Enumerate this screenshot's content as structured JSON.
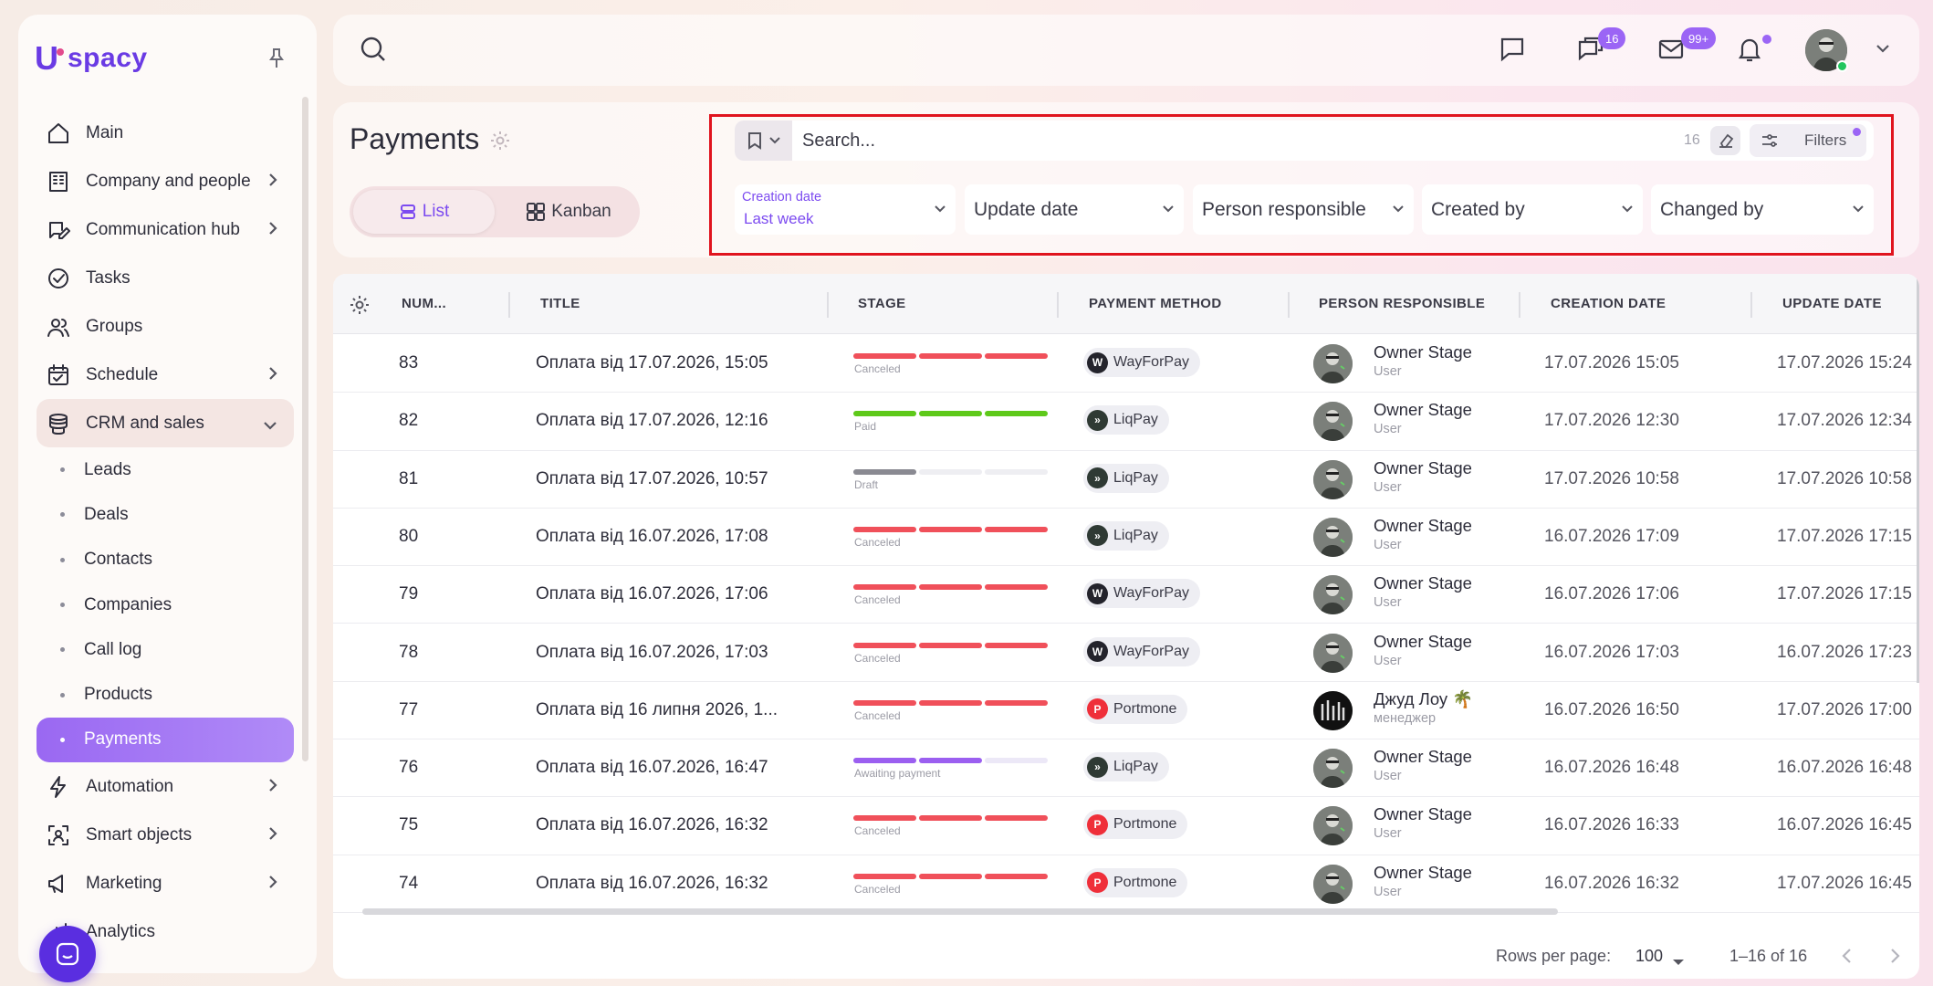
{
  "app": {
    "logo_text": "spacy",
    "logo_u": "U"
  },
  "sidebar": {
    "items": [
      {
        "label": "Main",
        "icon": "home-icon",
        "chevron": false
      },
      {
        "label": "Company and people",
        "icon": "building-icon",
        "chevron": true
      },
      {
        "label": "Communication hub",
        "icon": "edit-chat-icon",
        "chevron": true
      },
      {
        "label": "Tasks",
        "icon": "check-circle-icon",
        "chevron": false
      },
      {
        "label": "Groups",
        "icon": "users-icon",
        "chevron": false
      },
      {
        "label": "Schedule",
        "icon": "calendar-icon",
        "chevron": true
      },
      {
        "label": "CRM and sales",
        "icon": "coins-icon",
        "chevron": "down"
      }
    ],
    "crm_subitems": [
      "Leads",
      "Deals",
      "Contacts",
      "Companies",
      "Call log",
      "Products",
      "Payments"
    ],
    "active_subitem": "Payments",
    "bottom_items": [
      {
        "label": "Automation",
        "icon": "lightning-icon",
        "chevron": true
      },
      {
        "label": "Smart objects",
        "icon": "scan-face-icon",
        "chevron": true
      },
      {
        "label": "Marketing",
        "icon": "megaphone-icon",
        "chevron": true
      },
      {
        "label": "Analytics",
        "icon": "analytics-icon",
        "chevron": false
      }
    ]
  },
  "topbar": {
    "chat_badge": "16",
    "mail_badge": "99+"
  },
  "header": {
    "title": "Payments",
    "views": {
      "list": "List",
      "kanban": "Kanban"
    },
    "search_placeholder": "Search...",
    "search_count": "16",
    "filters_label": "Filters",
    "filters": {
      "creation_date_label": "Creation date",
      "creation_date_value": "Last week",
      "update_date": "Update date",
      "person_responsible": "Person responsible",
      "created_by": "Created by",
      "changed_by": "Changed by"
    }
  },
  "table": {
    "columns": [
      "NUM...",
      "TITLE",
      "STAGE",
      "PAYMENT METHOD",
      "PERSON RESPONSIBLE",
      "CREATION DATE",
      "UPDATE DATE"
    ],
    "rows": [
      {
        "num": "83",
        "title": "Оплата від 17.07.2026, 15:05",
        "stage": "Canceled",
        "method": "WayForPay",
        "person": "Owner Stage",
        "role": "User",
        "created": "17.07.2026 15:05",
        "updated": "17.07.2026 15:24"
      },
      {
        "num": "82",
        "title": "Оплата від 17.07.2026, 12:16",
        "stage": "Paid",
        "method": "LiqPay",
        "person": "Owner Stage",
        "role": "User",
        "created": "17.07.2026 12:30",
        "updated": "17.07.2026 12:34"
      },
      {
        "num": "81",
        "title": "Оплата від 17.07.2026, 10:57",
        "stage": "Draft",
        "method": "LiqPay",
        "person": "Owner Stage",
        "role": "User",
        "created": "17.07.2026 10:58",
        "updated": "17.07.2026 10:58"
      },
      {
        "num": "80",
        "title": "Оплата від 16.07.2026, 17:08",
        "stage": "Canceled",
        "method": "LiqPay",
        "person": "Owner Stage",
        "role": "User",
        "created": "16.07.2026 17:09",
        "updated": "17.07.2026 17:15"
      },
      {
        "num": "79",
        "title": "Оплата від 16.07.2026, 17:06",
        "stage": "Canceled",
        "method": "WayForPay",
        "person": "Owner Stage",
        "role": "User",
        "created": "16.07.2026 17:06",
        "updated": "17.07.2026 17:15"
      },
      {
        "num": "78",
        "title": "Оплата від 16.07.2026, 17:03",
        "stage": "Canceled",
        "method": "WayForPay",
        "person": "Owner Stage",
        "role": "User",
        "created": "16.07.2026 17:03",
        "updated": "16.07.2026 17:23"
      },
      {
        "num": "77",
        "title": "Оплата від 16 липня 2026, 1...",
        "stage": "Canceled",
        "method": "Portmone",
        "person": "Джуд Лоу 🌴",
        "role": "менеджер",
        "created": "16.07.2026 16:50",
        "updated": "17.07.2026 17:00"
      },
      {
        "num": "76",
        "title": "Оплата від 16.07.2026, 16:47",
        "stage": "Awaiting payment",
        "method": "LiqPay",
        "person": "Owner Stage",
        "role": "User",
        "created": "16.07.2026 16:48",
        "updated": "16.07.2026 16:48"
      },
      {
        "num": "75",
        "title": "Оплата від 16.07.2026, 16:32",
        "stage": "Canceled",
        "method": "Portmone",
        "person": "Owner Stage",
        "role": "User",
        "created": "16.07.2026 16:33",
        "updated": "16.07.2026 16:45"
      },
      {
        "num": "74",
        "title": "Оплата від 16.07.2026, 16:32",
        "stage": "Canceled",
        "method": "Portmone",
        "person": "Owner Stage",
        "role": "User",
        "created": "16.07.2026 16:32",
        "updated": "17.07.2026 16:45"
      }
    ],
    "stage_colors": {
      "Canceled": [
        "#f0505a",
        "#f0505a",
        "#f0505a"
      ],
      "Paid": [
        "#5ec91a",
        "#5ec91a",
        "#5ec91a"
      ],
      "Draft": [
        "#8a8a92",
        "#eeeef2",
        "#eeeef2"
      ],
      "Awaiting payment": [
        "#9b5ff0",
        "#9b5ff0",
        "#ece8f7"
      ]
    }
  },
  "footer": {
    "rows_per_page_label": "Rows per page:",
    "rows_per_page_value": "100",
    "range": "1–16 of 16"
  }
}
